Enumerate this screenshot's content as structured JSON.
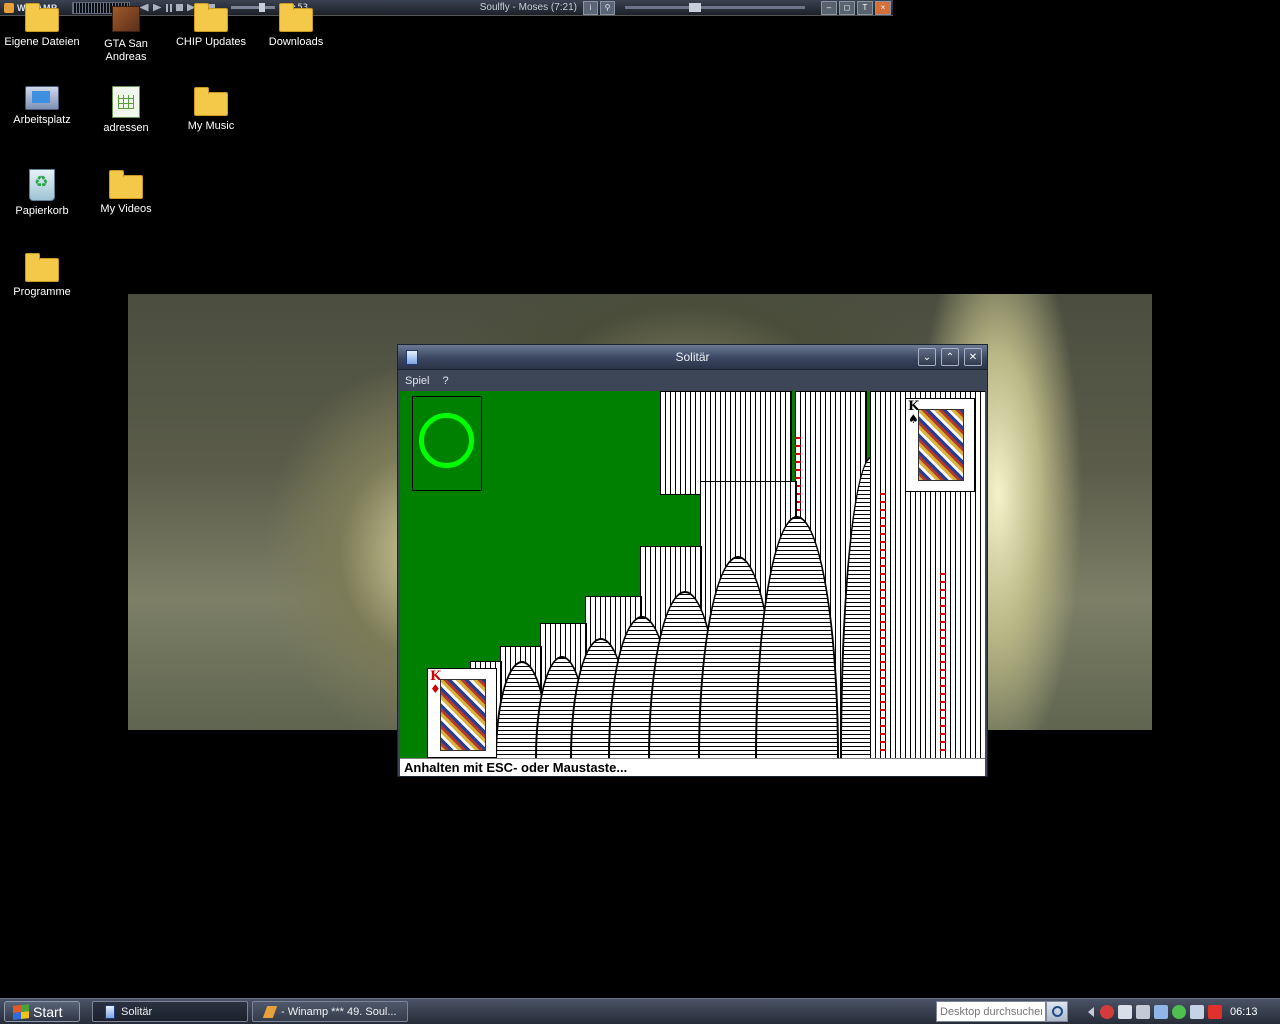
{
  "winamp": {
    "logo": "WINAMP",
    "time": "2:53",
    "song": "Soulfly - Moses (7:21)",
    "btn_info": "i",
    "btn_search": "⚲",
    "btn_min": "–",
    "btn_shade": "◻",
    "btn_top": "T",
    "btn_close": "×"
  },
  "desktop": {
    "icons": [
      {
        "label": "Eigene Dateien",
        "icon": "folder-icon"
      },
      {
        "label": "GTA San Andreas",
        "icon": "game-icon"
      },
      {
        "label": "CHIP Updates",
        "icon": "folder-icon"
      },
      {
        "label": "Downloads",
        "icon": "folder-icon"
      },
      {
        "label": "Arbeitsplatz",
        "icon": "computer-icon"
      },
      {
        "label": "adressen",
        "icon": "spreadsheet-icon"
      },
      {
        "label": "My Music",
        "icon": "folder-icon"
      },
      {
        "label": "Papierkorb",
        "icon": "recycle-bin-icon"
      },
      {
        "label": "My Videos",
        "icon": "folder-icon"
      },
      {
        "label": "Programme",
        "icon": "folder-icon"
      }
    ]
  },
  "solitaire": {
    "title": "Solitär",
    "menu": [
      "Spiel",
      "?"
    ],
    "status": "Anhalten mit ESC- oder Maustaste...",
    "card_king_spades": {
      "rank": "K",
      "suit": "♠"
    },
    "card_king_diamonds": {
      "rank": "K",
      "suit": "♦"
    },
    "btn_min": "⌄",
    "btn_max": "⌃",
    "btn_close": "✕",
    "felt_color": "#008000",
    "stock_ring_color": "#00ff00"
  },
  "taskbar": {
    "start": "Start",
    "tasks": [
      "Solitär",
      "- Winamp *** 49. Soul..."
    ],
    "search_placeholder": "Desktop durchsuchen",
    "clock": "06:13"
  }
}
